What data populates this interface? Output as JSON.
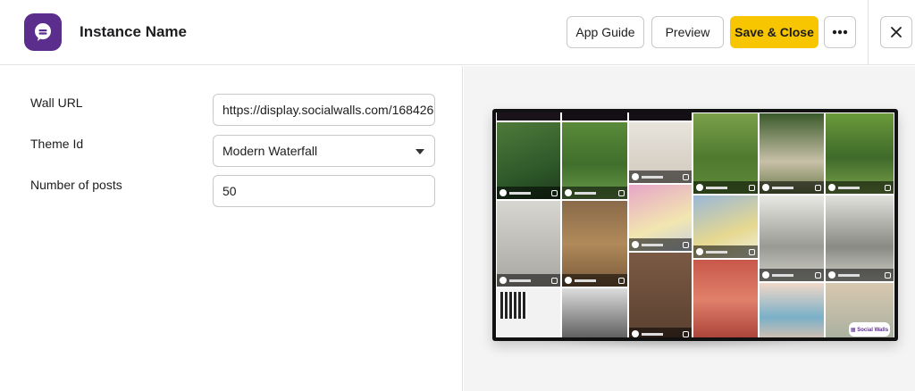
{
  "header": {
    "title": "Instance Name",
    "buttons": {
      "app_guide": "App Guide",
      "preview": "Preview",
      "save_close": "Save & Close"
    },
    "accent_color": "#f7c600",
    "logo_color": "#5b2d8c"
  },
  "form": {
    "fields": [
      {
        "label": "Wall URL",
        "value": "https://display.socialwalls.com/168426",
        "type": "text"
      },
      {
        "label": "Theme Id",
        "value": "Modern Waterfall",
        "type": "select"
      },
      {
        "label": "Number of posts",
        "value": "50",
        "type": "number"
      }
    ]
  },
  "icons": {
    "logo": "chat-bubble-icon",
    "more": "ellipsis-icon",
    "close": "close-icon",
    "dropdown": "chevron-down-icon"
  }
}
